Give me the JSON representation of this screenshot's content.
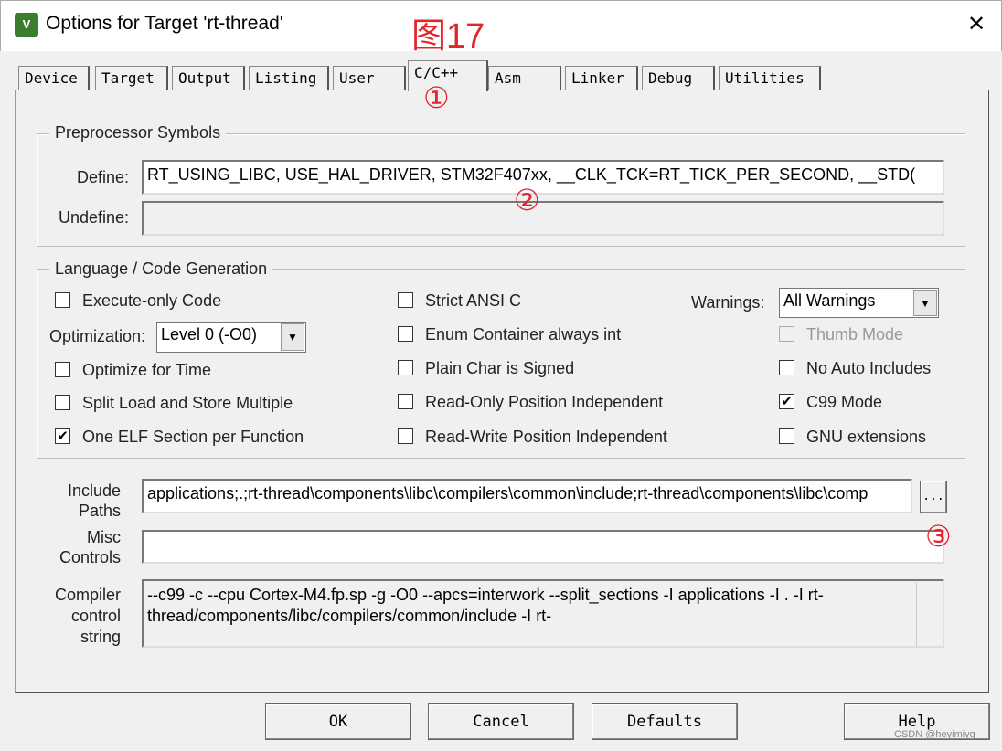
{
  "window": {
    "title": "Options for Target 'rt-thread'",
    "icon": "keil-uvision-icon",
    "close": "✕"
  },
  "annotations": {
    "figure": "图17",
    "mark1": "①",
    "mark2": "②",
    "mark3": "③",
    "color": "#e4252b"
  },
  "tabs": [
    "Device",
    "Target",
    "Output",
    "Listing",
    "User",
    "C/C++",
    "Asm",
    "Linker",
    "Debug",
    "Utilities"
  ],
  "active_tab": "C/C++",
  "preprocessor": {
    "title": "Preprocessor Symbols",
    "define_label": "Define:",
    "define_value": "RT_USING_LIBC, USE_HAL_DRIVER, STM32F407xx, __CLK_TCK=RT_TICK_PER_SECOND, __STD(",
    "undefine_label": "Undefine:",
    "undefine_value": ""
  },
  "language": {
    "title": "Language / Code Generation",
    "execute_only": {
      "label": "Execute-only Code",
      "checked": false
    },
    "optimization_label": "Optimization:",
    "optimization_value": "Level 0 (-O0)",
    "optimize_time": {
      "label": "Optimize for Time",
      "checked": false
    },
    "split_load": {
      "label": "Split Load and Store Multiple",
      "checked": false
    },
    "one_elf": {
      "label": "One ELF Section per Function",
      "checked": true
    },
    "strict_ansi": {
      "label": "Strict ANSI C",
      "checked": false
    },
    "enum_int": {
      "label": "Enum Container always int",
      "checked": false
    },
    "plain_char": {
      "label": "Plain Char is Signed",
      "checked": false
    },
    "ropi": {
      "label": "Read-Only Position Independent",
      "checked": false
    },
    "rwpi": {
      "label": "Read-Write Position Independent",
      "checked": false
    },
    "warnings_label": "Warnings:",
    "warnings_value": "All Warnings",
    "thumb": {
      "label": "Thumb Mode",
      "checked": false,
      "disabled": true
    },
    "no_auto": {
      "label": "No Auto Includes",
      "checked": false
    },
    "c99": {
      "label": "C99 Mode",
      "checked": true
    },
    "gnu": {
      "label": "GNU extensions",
      "checked": false
    },
    "check": "✔"
  },
  "include": {
    "label1": "Include",
    "label2": "Paths",
    "value": "applications;.;rt-thread\\components\\libc\\compilers\\common\\include;rt-thread\\components\\libc\\comp",
    "browse": "..."
  },
  "misc": {
    "label1": "Misc",
    "label2": "Controls",
    "value": ""
  },
  "compiler": {
    "label1": "Compiler",
    "label2": "control",
    "label3": "string",
    "value": "--c99 -c --cpu Cortex-M4.fp.sp -g -O0 --apcs=interwork --split_sections -I applications -I . -I rt-thread/components/libc/compilers/common/include -I rt-"
  },
  "buttons": {
    "ok": "OK",
    "cancel": "Cancel",
    "defaults": "Defaults",
    "help": "Help"
  },
  "watermark": "CSDN @heyimiyg"
}
